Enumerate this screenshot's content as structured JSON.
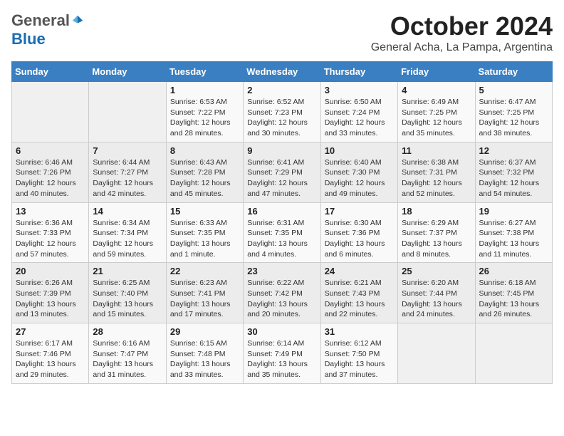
{
  "header": {
    "logo": {
      "general": "General",
      "blue": "Blue"
    },
    "title": "October 2024",
    "subtitle": "General Acha, La Pampa, Argentina"
  },
  "days_of_week": [
    "Sunday",
    "Monday",
    "Tuesday",
    "Wednesday",
    "Thursday",
    "Friday",
    "Saturday"
  ],
  "weeks": [
    [
      {
        "day": "",
        "detail": ""
      },
      {
        "day": "",
        "detail": ""
      },
      {
        "day": "1",
        "detail": "Sunrise: 6:53 AM\nSunset: 7:22 PM\nDaylight: 12 hours and 28 minutes."
      },
      {
        "day": "2",
        "detail": "Sunrise: 6:52 AM\nSunset: 7:23 PM\nDaylight: 12 hours and 30 minutes."
      },
      {
        "day": "3",
        "detail": "Sunrise: 6:50 AM\nSunset: 7:24 PM\nDaylight: 12 hours and 33 minutes."
      },
      {
        "day": "4",
        "detail": "Sunrise: 6:49 AM\nSunset: 7:25 PM\nDaylight: 12 hours and 35 minutes."
      },
      {
        "day": "5",
        "detail": "Sunrise: 6:47 AM\nSunset: 7:25 PM\nDaylight: 12 hours and 38 minutes."
      }
    ],
    [
      {
        "day": "6",
        "detail": "Sunrise: 6:46 AM\nSunset: 7:26 PM\nDaylight: 12 hours and 40 minutes."
      },
      {
        "day": "7",
        "detail": "Sunrise: 6:44 AM\nSunset: 7:27 PM\nDaylight: 12 hours and 42 minutes."
      },
      {
        "day": "8",
        "detail": "Sunrise: 6:43 AM\nSunset: 7:28 PM\nDaylight: 12 hours and 45 minutes."
      },
      {
        "day": "9",
        "detail": "Sunrise: 6:41 AM\nSunset: 7:29 PM\nDaylight: 12 hours and 47 minutes."
      },
      {
        "day": "10",
        "detail": "Sunrise: 6:40 AM\nSunset: 7:30 PM\nDaylight: 12 hours and 49 minutes."
      },
      {
        "day": "11",
        "detail": "Sunrise: 6:38 AM\nSunset: 7:31 PM\nDaylight: 12 hours and 52 minutes."
      },
      {
        "day": "12",
        "detail": "Sunrise: 6:37 AM\nSunset: 7:32 PM\nDaylight: 12 hours and 54 minutes."
      }
    ],
    [
      {
        "day": "13",
        "detail": "Sunrise: 6:36 AM\nSunset: 7:33 PM\nDaylight: 12 hours and 57 minutes."
      },
      {
        "day": "14",
        "detail": "Sunrise: 6:34 AM\nSunset: 7:34 PM\nDaylight: 12 hours and 59 minutes."
      },
      {
        "day": "15",
        "detail": "Sunrise: 6:33 AM\nSunset: 7:35 PM\nDaylight: 13 hours and 1 minute."
      },
      {
        "day": "16",
        "detail": "Sunrise: 6:31 AM\nSunset: 7:35 PM\nDaylight: 13 hours and 4 minutes."
      },
      {
        "day": "17",
        "detail": "Sunrise: 6:30 AM\nSunset: 7:36 PM\nDaylight: 13 hours and 6 minutes."
      },
      {
        "day": "18",
        "detail": "Sunrise: 6:29 AM\nSunset: 7:37 PM\nDaylight: 13 hours and 8 minutes."
      },
      {
        "day": "19",
        "detail": "Sunrise: 6:27 AM\nSunset: 7:38 PM\nDaylight: 13 hours and 11 minutes."
      }
    ],
    [
      {
        "day": "20",
        "detail": "Sunrise: 6:26 AM\nSunset: 7:39 PM\nDaylight: 13 hours and 13 minutes."
      },
      {
        "day": "21",
        "detail": "Sunrise: 6:25 AM\nSunset: 7:40 PM\nDaylight: 13 hours and 15 minutes."
      },
      {
        "day": "22",
        "detail": "Sunrise: 6:23 AM\nSunset: 7:41 PM\nDaylight: 13 hours and 17 minutes."
      },
      {
        "day": "23",
        "detail": "Sunrise: 6:22 AM\nSunset: 7:42 PM\nDaylight: 13 hours and 20 minutes."
      },
      {
        "day": "24",
        "detail": "Sunrise: 6:21 AM\nSunset: 7:43 PM\nDaylight: 13 hours and 22 minutes."
      },
      {
        "day": "25",
        "detail": "Sunrise: 6:20 AM\nSunset: 7:44 PM\nDaylight: 13 hours and 24 minutes."
      },
      {
        "day": "26",
        "detail": "Sunrise: 6:18 AM\nSunset: 7:45 PM\nDaylight: 13 hours and 26 minutes."
      }
    ],
    [
      {
        "day": "27",
        "detail": "Sunrise: 6:17 AM\nSunset: 7:46 PM\nDaylight: 13 hours and 29 minutes."
      },
      {
        "day": "28",
        "detail": "Sunrise: 6:16 AM\nSunset: 7:47 PM\nDaylight: 13 hours and 31 minutes."
      },
      {
        "day": "29",
        "detail": "Sunrise: 6:15 AM\nSunset: 7:48 PM\nDaylight: 13 hours and 33 minutes."
      },
      {
        "day": "30",
        "detail": "Sunrise: 6:14 AM\nSunset: 7:49 PM\nDaylight: 13 hours and 35 minutes."
      },
      {
        "day": "31",
        "detail": "Sunrise: 6:12 AM\nSunset: 7:50 PM\nDaylight: 13 hours and 37 minutes."
      },
      {
        "day": "",
        "detail": ""
      },
      {
        "day": "",
        "detail": ""
      }
    ]
  ]
}
